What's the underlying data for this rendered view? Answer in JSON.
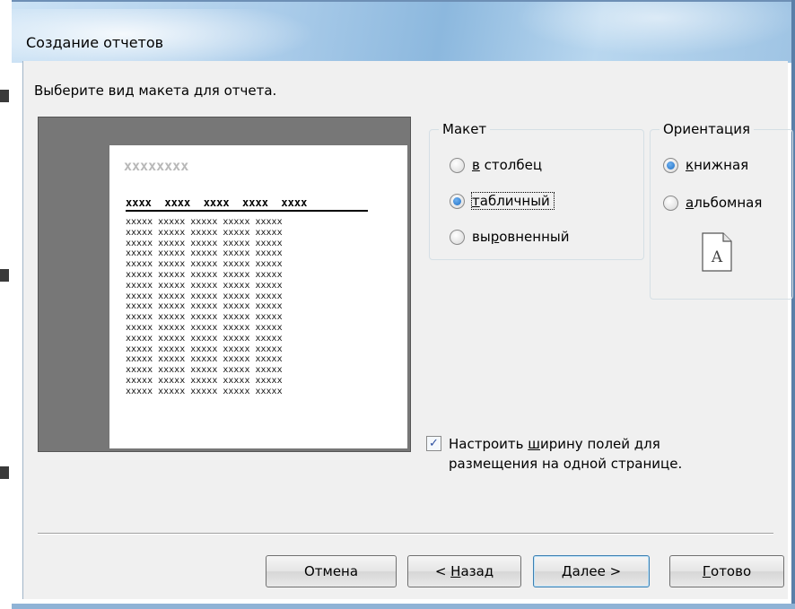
{
  "window": {
    "title": "Создание отчетов"
  },
  "instruction": "Выберите вид макета для отчета.",
  "preview": {
    "title_placeholder": "xxxxxxxx",
    "header_row": "xxxx  xxxx  xxxx  xxxx  xxxx",
    "data_rows": [
      "xxxxx xxxxx xxxxx xxxxx xxxxx",
      "xxxxx xxxxx xxxxx xxxxx xxxxx",
      "xxxxx xxxxx xxxxx xxxxx xxxxx",
      "xxxxx xxxxx xxxxx xxxxx xxxxx",
      "xxxxx xxxxx xxxxx xxxxx xxxxx",
      "xxxxx xxxxx xxxxx xxxxx xxxxx",
      "xxxxx xxxxx xxxxx xxxxx xxxxx",
      "xxxxx xxxxx xxxxx xxxxx xxxxx",
      "xxxxx xxxxx xxxxx xxxxx xxxxx",
      "xxxxx xxxxx xxxxx xxxxx xxxxx",
      "xxxxx xxxxx xxxxx xxxxx xxxxx",
      "xxxxx xxxxx xxxxx xxxxx xxxxx",
      "xxxxx xxxxx xxxxx xxxxx xxxxx",
      "xxxxx xxxxx xxxxx xxxxx xxxxx",
      "xxxxx xxxxx xxxxx xxxxx xxxxx",
      "xxxxx xxxxx xxxxx xxxxx xxxxx",
      "xxxxx xxxxx xxxxx xxxxx xxxxx"
    ]
  },
  "layout_group": {
    "label": "Макет",
    "options": [
      {
        "hotkey": "в",
        "rest": " столбец",
        "checked": false
      },
      {
        "hotkey": "т",
        "rest": "абличный",
        "checked": true
      },
      {
        "pre": "вы",
        "hotkey": "р",
        "rest": "овненный",
        "checked": false
      }
    ]
  },
  "orientation_group": {
    "label": "Ориентация",
    "options": [
      {
        "hotkey": "к",
        "rest": "нижная",
        "checked": true
      },
      {
        "hotkey": "а",
        "rest": "льбомная",
        "checked": false
      }
    ],
    "page_letter": "A"
  },
  "fit_checkbox": {
    "checked": true,
    "line1_pre": "Настроить ",
    "line1_hotkey": "ш",
    "line1_rest": "ирину полей для",
    "line2": "размещения на одной странице."
  },
  "buttons": {
    "cancel": "Отмена",
    "back_prefix": "< ",
    "back_hotkey": "Н",
    "back_rest": "азад",
    "next_hotkey": "Д",
    "next_rest": "алее >",
    "finish_hotkey": "Г",
    "finish_rest": "отово"
  },
  "colors": {
    "titlebar": "#a9cbe9",
    "dialog_bg": "#f0f0f0",
    "preview_bg": "#777777",
    "radio_dot": "#1f6fc5",
    "default_button_border": "#3c7fb1"
  }
}
